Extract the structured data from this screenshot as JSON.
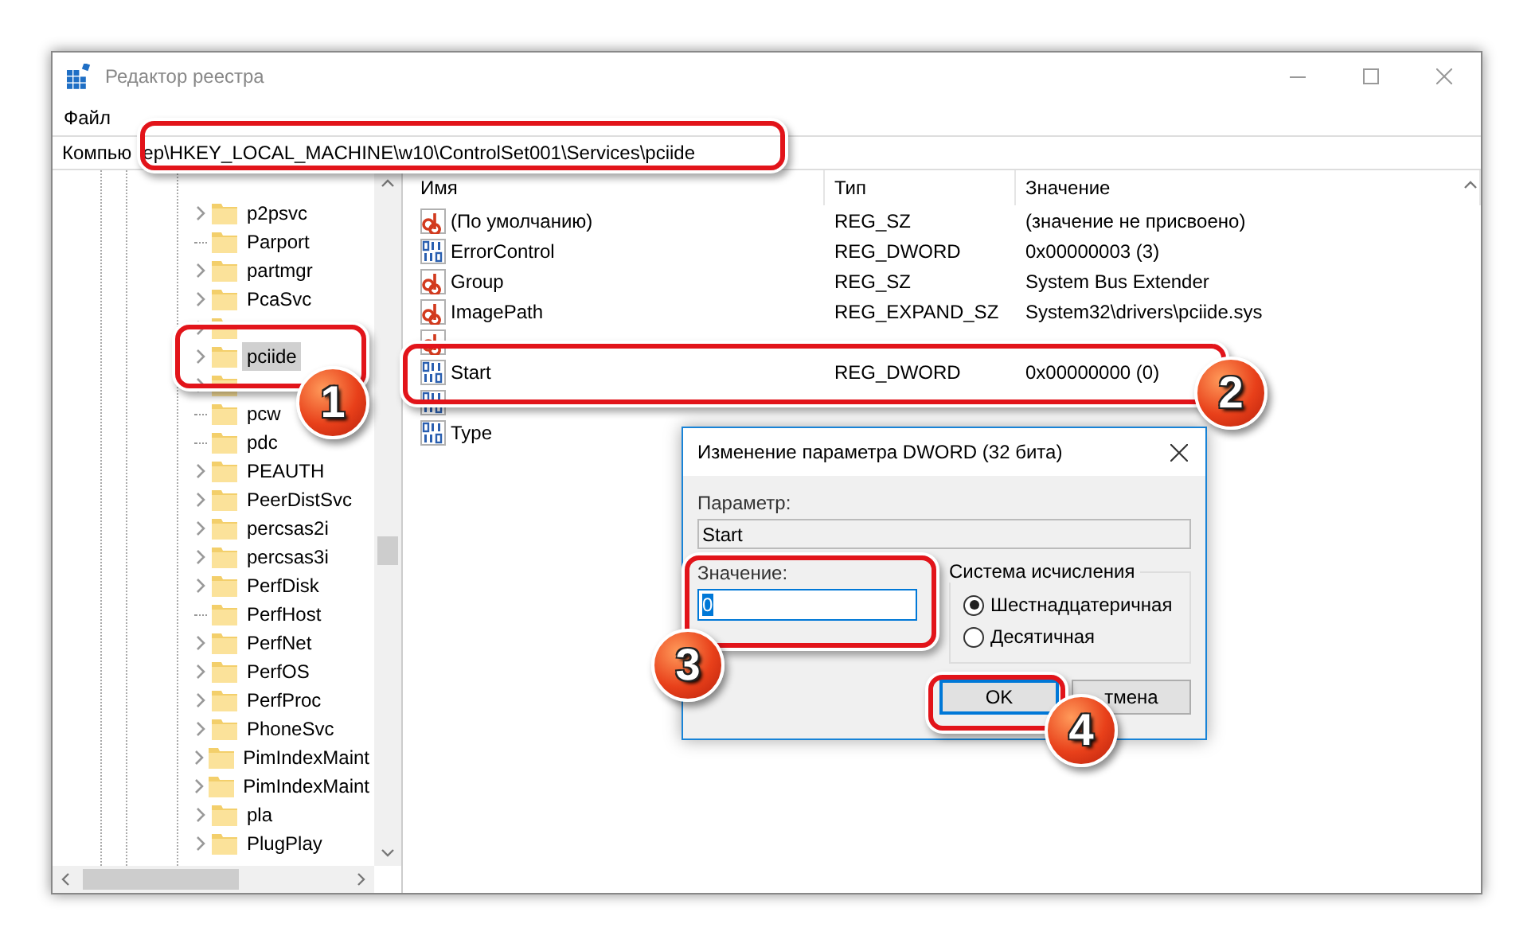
{
  "window": {
    "title": "Редактор реестра"
  },
  "menu": [
    "Файл"
  ],
  "address": [
    "Компью",
    "ер\\HKEY_LOCAL_MACHINE\\w10\\ControlSet001\\Services\\pciide"
  ],
  "tree": {
    "items": [
      {
        "label": "p2psvc",
        "has_children": true,
        "selected": false
      },
      {
        "label": "Parport",
        "has_children": false,
        "selected": false
      },
      {
        "label": "partmgr",
        "has_children": true,
        "selected": false
      },
      {
        "label": "PcaSvc",
        "has_children": true,
        "selected": false
      },
      {
        "has_children": true,
        "selected": false
      },
      {
        "label": "pciide",
        "has_children": true,
        "selected": true
      },
      {
        "has_children": true,
        "selected": false
      },
      {
        "label": "pcw",
        "has_children": false,
        "selected": false
      },
      {
        "label": "pdc",
        "has_children": false,
        "selected": false
      },
      {
        "label": "PEAUTH",
        "has_children": true,
        "selected": false
      },
      {
        "label": "PeerDistSvc",
        "has_children": true,
        "selected": false
      },
      {
        "label": "percsas2i",
        "has_children": true,
        "selected": false
      },
      {
        "label": "percsas3i",
        "has_children": true,
        "selected": false
      },
      {
        "label": "PerfDisk",
        "has_children": true,
        "selected": false
      },
      {
        "label": "PerfHost",
        "has_children": false,
        "selected": false
      },
      {
        "label": "PerfNet",
        "has_children": true,
        "selected": false
      },
      {
        "label": "PerfOS",
        "has_children": true,
        "selected": false
      },
      {
        "label": "PerfProc",
        "has_children": true,
        "selected": false
      },
      {
        "label": "PhoneSvc",
        "has_children": true,
        "selected": false
      },
      {
        "label": "PimIndexMaint",
        "has_children": true,
        "selected": false
      },
      {
        "label": "PimIndexMaint",
        "has_children": true,
        "selected": false
      },
      {
        "label": "pla",
        "has_children": true,
        "selected": false
      },
      {
        "label": "PlugPlay",
        "has_children": true,
        "selected": false
      }
    ]
  },
  "values": {
    "columns": [
      "Имя",
      "Тип",
      "Значение"
    ],
    "rows": [
      {
        "kind": "string",
        "name": "(По умолчанию)",
        "type": "REG_SZ",
        "data": "(значение не присвоено)",
        "selected": false
      },
      {
        "kind": "dword",
        "name": "ErrorControl",
        "type": "REG_DWORD",
        "data": "0x00000003 (3)",
        "selected": false
      },
      {
        "kind": "string",
        "name": "Group",
        "type": "REG_SZ",
        "data": "System Bus Extender",
        "selected": false
      },
      {
        "kind": "string",
        "name": "ImagePath",
        "type": "REG_EXPAND_SZ",
        "data": "System32\\drivers\\pciide.sys",
        "selected": false
      },
      {
        "kind": "string",
        "selected": false
      },
      {
        "kind": "dword",
        "name": "Start",
        "type": "REG_DWORD",
        "data": "0x00000000 (0)",
        "selected": false
      },
      {
        "kind": "dword",
        "selected": false
      },
      {
        "kind": "dword",
        "name": "Type",
        "selected": false
      }
    ]
  },
  "dialog": {
    "title": "Изменение параметра DWORD (32 бита)",
    "name_label": "Параметр:",
    "name_value": "Start",
    "value_label": "Значение:",
    "value": "0",
    "value_highlighted": true,
    "base_group": "Система исчисления",
    "bases": [
      {
        "label": "Шестнадцатеричная",
        "selected": true
      },
      {
        "label": "Десятичная",
        "selected": false
      }
    ],
    "buttons": [
      {
        "label": "OK",
        "default": true
      },
      {
        "label": "тмена",
        "default": false
      }
    ]
  },
  "callouts": [
    "1",
    "2",
    "3",
    "4"
  ]
}
